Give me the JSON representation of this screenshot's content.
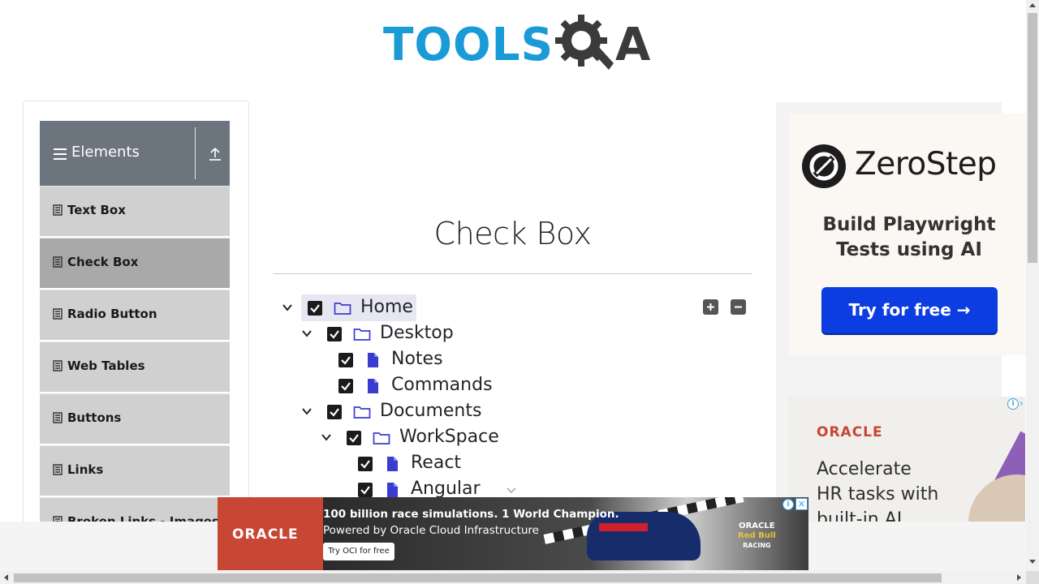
{
  "header": {
    "logo_text": "TOOLS",
    "logo_suffix": "A"
  },
  "sidebar": {
    "group_title": "Elements",
    "items": [
      {
        "label": "Text Box",
        "active": false
      },
      {
        "label": "Check Box",
        "active": true
      },
      {
        "label": "Radio Button",
        "active": false
      },
      {
        "label": "Web Tables",
        "active": false
      },
      {
        "label": "Buttons",
        "active": false
      },
      {
        "label": "Links",
        "active": false
      },
      {
        "label": "Broken Links - Images",
        "active": false
      }
    ]
  },
  "main": {
    "title": "Check Box",
    "tree": [
      {
        "label": "Home",
        "type": "folder",
        "expanded": true,
        "checked": true
      },
      {
        "label": "Desktop",
        "type": "folder",
        "expanded": true,
        "checked": true
      },
      {
        "label": "Notes",
        "type": "file",
        "checked": true
      },
      {
        "label": "Commands",
        "type": "file",
        "checked": true
      },
      {
        "label": "Documents",
        "type": "folder",
        "expanded": true,
        "checked": true
      },
      {
        "label": "WorkSpace",
        "type": "folder",
        "expanded": true,
        "checked": true
      },
      {
        "label": "React",
        "type": "file",
        "checked": true
      },
      {
        "label": "Angular",
        "type": "file",
        "checked": true
      }
    ],
    "expand_all_icon": "plus-square-icon",
    "collapse_all_icon": "minus-square-icon"
  },
  "right_ad": {
    "brand": "ZeroStep",
    "tagline_line1": "Build Playwright",
    "tagline_line2": "Tests using AI",
    "cta": "Try for free →",
    "oracle_logo": "ORACLE",
    "oracle_line1": "Accelerate",
    "oracle_line2": "HR tasks with",
    "oracle_line3": "built-in AI"
  },
  "bottom_ad": {
    "brand": "ORACLE",
    "headline": "100 billion race simulations. 1 World Champion.",
    "subline": "Powered by Oracle Cloud Infrastructure",
    "button": "Try OCI for free",
    "partner_line1": "ORACLE",
    "partner_line2": "Red Bull",
    "partner_line3": "RACING"
  },
  "colors": {
    "brand_blue": "#1a9ad6",
    "sidebar_header": "#6c757d",
    "menu_item": "#d0d0d0",
    "menu_item_active": "#a9a9a9",
    "tree_icon": "#3b3bd1",
    "zerostep_cta": "#0b3de0",
    "oracle_red": "#c74634"
  }
}
